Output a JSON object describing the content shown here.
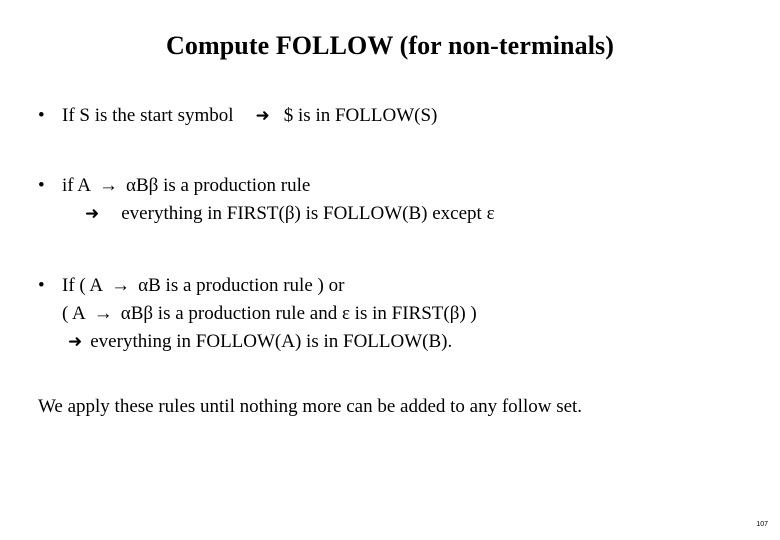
{
  "slide": {
    "title": "Compute FOLLOW (for non-terminals)",
    "page_number": "107",
    "closing_text": "We apply these rules until nothing more can be added to any follow set.",
    "bullet_marker": "•",
    "fat_arrow_glyph": "➜",
    "thin_arrow_glyph": "→",
    "bullets": [
      {
        "line1_a": "If S is the start symbol",
        "line1_b": "$ is in FOLLOW(S)"
      },
      {
        "line1_a": "if  A",
        "line1_b": "αBβ  is a production rule",
        "line2": "everything in FIRST(β) is FOLLOW(B) except ε"
      },
      {
        "line1_a": "If  ( A",
        "line1_b": "αB is a production rule )   or",
        "line2_a": "( A",
        "line2_b": "αBβ is a production rule and ε is in FIRST(β) )",
        "line3": "everything in FOLLOW(A) is in FOLLOW(B)."
      }
    ]
  }
}
